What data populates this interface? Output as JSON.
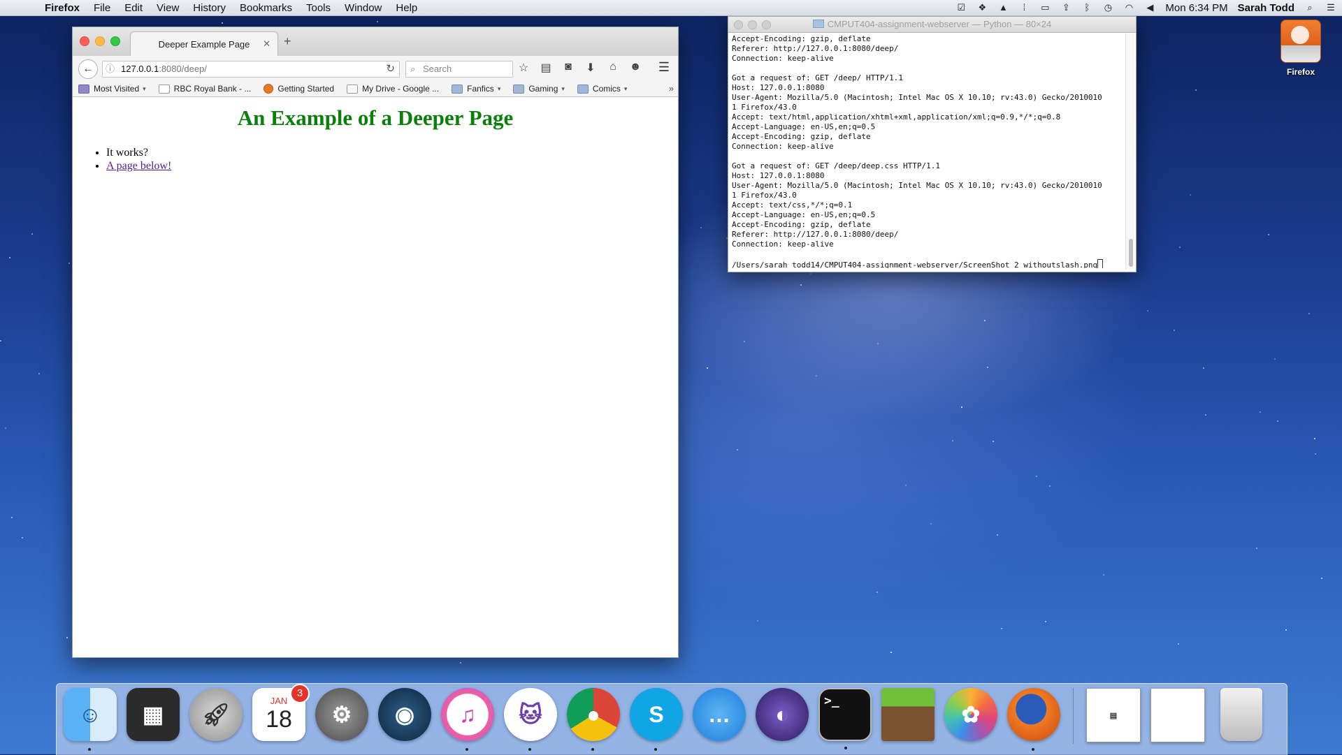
{
  "menubar": {
    "app_name": "Firefox",
    "menus": [
      "File",
      "Edit",
      "View",
      "History",
      "Bookmarks",
      "Tools",
      "Window",
      "Help"
    ],
    "status_icons": [
      "checkbox-icon",
      "dropbox-icon",
      "drive-icon",
      "grid-icon",
      "display-icon",
      "up-icon",
      "bluetooth-icon",
      "time-machine-icon",
      "wifi-icon",
      "volume-icon"
    ],
    "clock": "Mon 6:34 PM",
    "user": "Sarah Todd"
  },
  "browser": {
    "tab_title": "Deeper Example Page",
    "url_host": "127.0.0.1",
    "url_path": ":8080/deep/",
    "search_placeholder": "Search",
    "bookmarks": [
      {
        "label": "Most Visited",
        "icon": "most-visited-icon",
        "has_menu": true
      },
      {
        "label": "RBC Royal Bank - ...",
        "icon": "page-icon",
        "has_menu": false
      },
      {
        "label": "Getting Started",
        "icon": "firefox-icon",
        "has_menu": false
      },
      {
        "label": "My Drive - Google ...",
        "icon": "page-icon",
        "has_menu": false
      },
      {
        "label": "Fanfics",
        "icon": "folder-icon",
        "has_menu": true
      },
      {
        "label": "Gaming",
        "icon": "folder-icon",
        "has_menu": true
      },
      {
        "label": "Comics",
        "icon": "folder-icon",
        "has_menu": true
      }
    ],
    "page": {
      "heading": "An Example of a Deeper Page",
      "items": [
        "It works?",
        "A page below!"
      ],
      "heading_color": "#0a7f0a"
    }
  },
  "terminal": {
    "title": "CMPUT404-assignment-webserver — Python — 80×24",
    "lines": [
      "Accept-Encoding: gzip, deflate",
      "Referer: http://127.0.0.1:8080/deep/",
      "Connection: keep-alive",
      "",
      "Got a request of: GET /deep/ HTTP/1.1",
      "Host: 127.0.0.1:8080",
      "User-Agent: Mozilla/5.0 (Macintosh; Intel Mac OS X 10.10; rv:43.0) Gecko/2010010",
      "1 Firefox/43.0",
      "Accept: text/html,application/xhtml+xml,application/xml;q=0.9,*/*;q=0.8",
      "Accept-Language: en-US,en;q=0.5",
      "Accept-Encoding: gzip, deflate",
      "Connection: keep-alive",
      "",
      "Got a request of: GET /deep/deep.css HTTP/1.1",
      "Host: 127.0.0.1:8080",
      "User-Agent: Mozilla/5.0 (Macintosh; Intel Mac OS X 10.10; rv:43.0) Gecko/2010010",
      "1 Firefox/43.0",
      "Accept: text/css,*/*;q=0.1",
      "Accept-Language: en-US,en;q=0.5",
      "Accept-Encoding: gzip, deflate",
      "Referer: http://127.0.0.1:8080/deep/",
      "Connection: keep-alive",
      "",
      "/Users/sarah_todd14/CMPUT404-assignment-webserver/ScreenShot_2_withoutslash.png"
    ]
  },
  "desktop": {
    "items": [
      {
        "label": "Firefox",
        "icon": "firefox-drive-icon"
      }
    ]
  },
  "dock": {
    "apps": [
      {
        "name": "finder",
        "running": true
      },
      {
        "name": "mission-control",
        "running": false
      },
      {
        "name": "launchpad",
        "running": false
      },
      {
        "name": "calendar",
        "running": false,
        "month": "JAN",
        "day": "18",
        "badge": "3"
      },
      {
        "name": "system-preferences",
        "running": false
      },
      {
        "name": "steam",
        "running": false
      },
      {
        "name": "itunes",
        "running": true
      },
      {
        "name": "github",
        "running": true
      },
      {
        "name": "chrome",
        "running": true
      },
      {
        "name": "skype",
        "running": true
      },
      {
        "name": "messages",
        "running": false
      },
      {
        "name": "eclipse",
        "running": false
      },
      {
        "name": "terminal",
        "running": true
      },
      {
        "name": "minecraft",
        "running": false
      },
      {
        "name": "photos",
        "running": false
      },
      {
        "name": "firefox",
        "running": true
      }
    ]
  }
}
